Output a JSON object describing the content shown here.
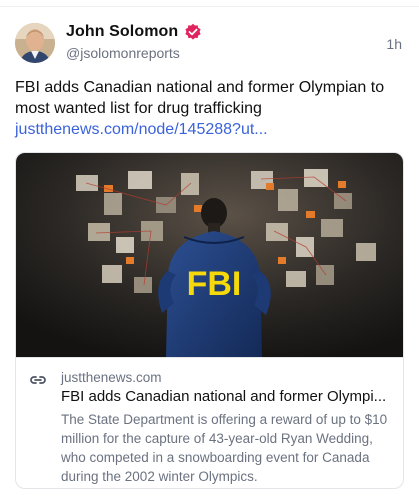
{
  "post": {
    "author_name": "John Solomon",
    "handle": "@jsolomonreports",
    "time": "1h",
    "text": "FBI adds Canadian national and former Olympian to most wanted list for drug trafficking ",
    "link_text": "justthenews.com/node/145288?ut..."
  },
  "card": {
    "jacket_text": "FBI",
    "domain": "justthenews.com",
    "title": "FBI adds Canadian national and former Olympi...",
    "description": "The State Department is offering a reward of up to $10 million for the capture of 43-year-old Ryan Wedding, who competed in a snowboarding event for Canada during the 2002 winter Olympics."
  },
  "icons": {
    "verified": "verified-badge-icon",
    "link": "link-icon"
  },
  "colors": {
    "link": "#3b63d9",
    "verified": "#e0245e",
    "jacket": "#1f3d78",
    "jacket_text": "#f5d90a"
  }
}
